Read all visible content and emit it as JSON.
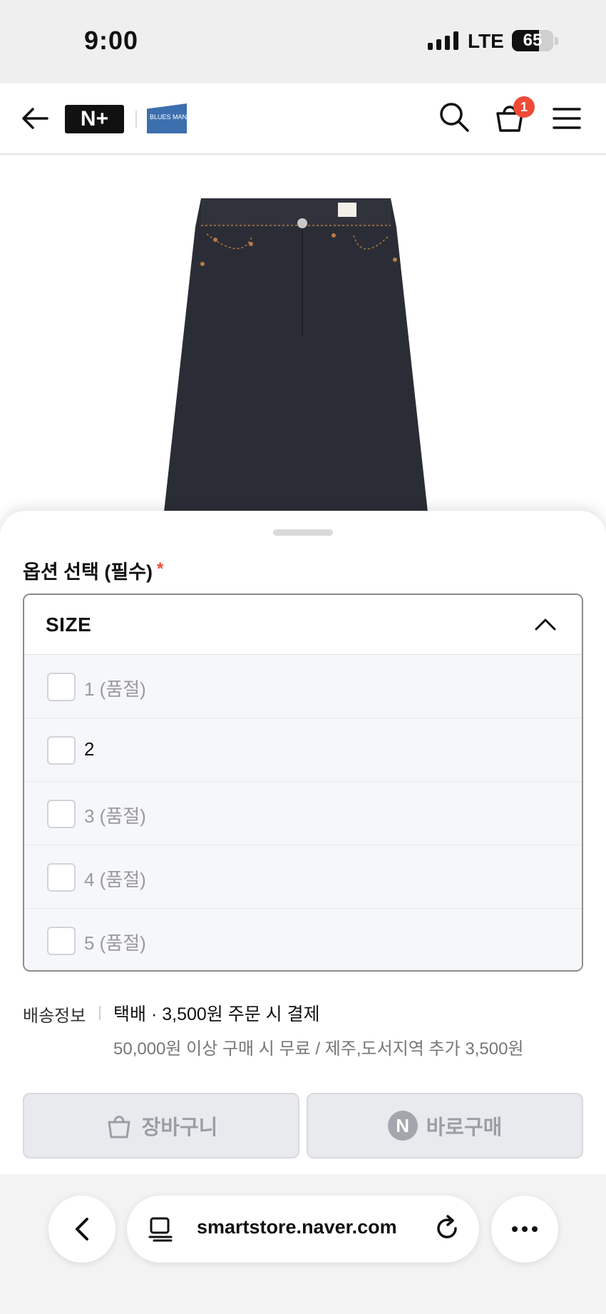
{
  "status_bar": {
    "time": "9:00",
    "network": "LTE",
    "battery": "65",
    "battery_level": 0.65
  },
  "header": {
    "brand_logo": "N+",
    "store_logo": "BLUES MAN",
    "cart_count": "1",
    "icons": [
      "arrow-left-icon",
      "search-icon",
      "cart-icon",
      "hamburger-menu-icon"
    ]
  },
  "option_sheet": {
    "title": "옵션 선택 (필수)",
    "required_mark": "*",
    "select_label": "SIZE",
    "options": [
      {
        "label": "1 (품절)",
        "available": false
      },
      {
        "label": "2",
        "available": true
      },
      {
        "label": "3 (품절)",
        "available": false
      },
      {
        "label": "4 (품절)",
        "available": false
      },
      {
        "label": "5 (품절)",
        "available": false
      }
    ]
  },
  "shipping": {
    "label": "배송정보",
    "method": "택배 · 3,500원 주문 시 결제",
    "note": "50,000원 이상 구매 시 무료 / 제주,도서지역 추가 3,500원"
  },
  "actions": {
    "cart_label": "장바구니",
    "buy_badge": "N",
    "buy_label": "바로구매"
  },
  "browser": {
    "url": "smartstore.naver.com"
  },
  "colors": {
    "accent_red": "#ef4a36",
    "denim": "#2b2d36",
    "disabled_button": "#e9eaee"
  }
}
